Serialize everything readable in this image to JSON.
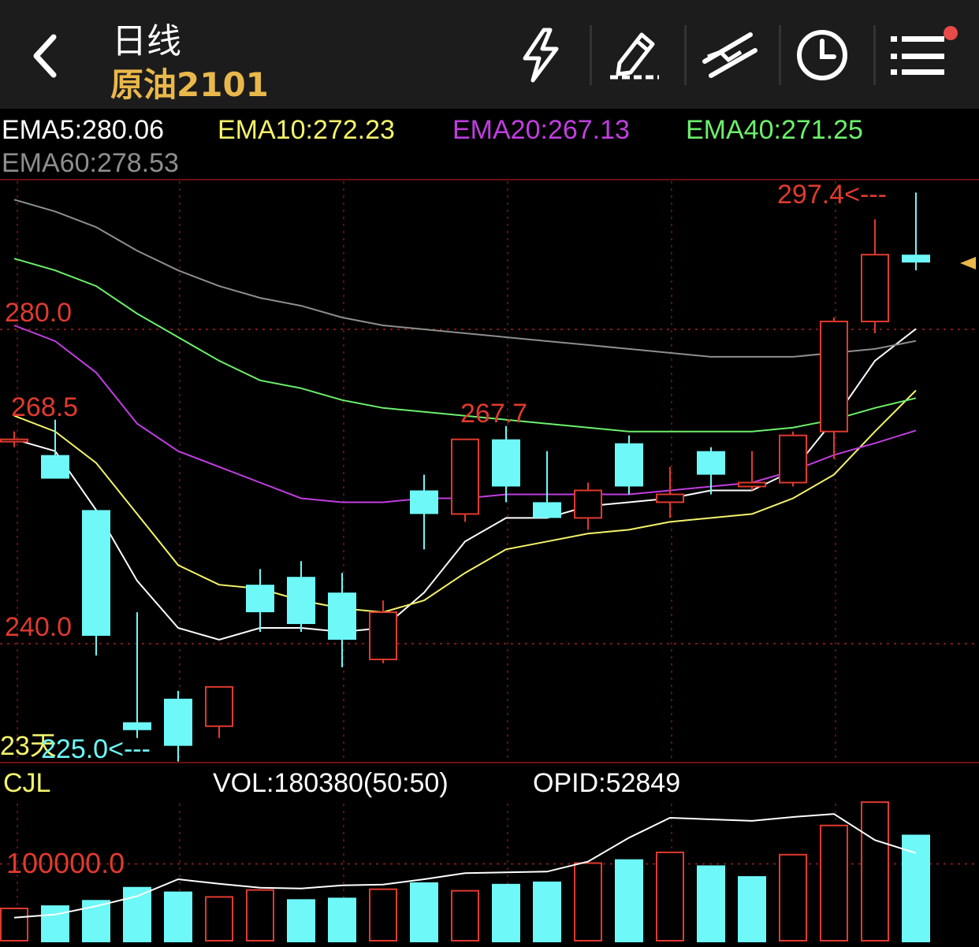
{
  "header": {
    "back_icon": "chevron-left-icon",
    "period": "日线",
    "instrument": "原油2101",
    "instrument_color": "#e9b84a",
    "buttons": [
      {
        "id": "flash",
        "icon": "lightning-icon"
      },
      {
        "id": "draw",
        "icon": "pen-draw-icon"
      },
      {
        "id": "trend",
        "icon": "trendline-icon"
      },
      {
        "id": "clock",
        "icon": "clock-icon"
      },
      {
        "id": "menu",
        "icon": "menu-icon",
        "badge_color": "#e84a4a"
      }
    ]
  },
  "ema_legend": [
    {
      "label": "EMA5:280.06",
      "color": "#ffffff"
    },
    {
      "label": "EMA10:272.23",
      "color": "#f4f46a"
    },
    {
      "label": "EMA20:267.13",
      "color": "#c03ee0"
    },
    {
      "label": "EMA40:271.25",
      "color": "#6cf06c"
    },
    {
      "label": "EMA60:278.53",
      "color": "#8e8e8e"
    }
  ],
  "chart_data": [
    {
      "type": "candlestick",
      "price_labels": {
        "level_280": "280.0",
        "level_268": "268.5",
        "level_240": "240.0",
        "level_267": "267.7"
      },
      "high_marker": "297.4<---",
      "low_marker": "225.0<---",
      "days_label": "23天",
      "gridlines": [
        295.0,
        280.0,
        240.0
      ],
      "up_color": "#e03a2e",
      "down_color": "#6ef8f8",
      "candles": [
        {
          "o": 266.0,
          "h": 267.0,
          "l": 265.0,
          "c": 266.0
        },
        {
          "o": 264.0,
          "h": 268.5,
          "l": 261.0,
          "c": 261.0
        },
        {
          "o": 257.0,
          "h": 257.0,
          "l": 238.5,
          "c": 241.0
        },
        {
          "o": 230.0,
          "h": 244.0,
          "l": 228.0,
          "c": 229.0
        },
        {
          "o": 233.0,
          "h": 234.0,
          "l": 225.0,
          "c": 227.0
        },
        {
          "o": 229.5,
          "h": 234.5,
          "l": 228.0,
          "c": 234.5
        },
        {
          "o": 247.5,
          "h": 249.5,
          "l": 241.5,
          "c": 244.0
        },
        {
          "o": 248.5,
          "h": 250.5,
          "l": 241.5,
          "c": 242.5
        },
        {
          "o": 246.5,
          "h": 249.0,
          "l": 237.0,
          "c": 240.5
        },
        {
          "o": 238.0,
          "h": 245.5,
          "l": 237.5,
          "c": 244.0
        },
        {
          "o": 259.5,
          "h": 261.5,
          "l": 252.0,
          "c": 256.5
        },
        {
          "o": 256.5,
          "h": 266.0,
          "l": 255.5,
          "c": 266.0
        },
        {
          "o": 266.0,
          "h": 267.7,
          "l": 258.0,
          "c": 260.0
        },
        {
          "o": 258.0,
          "h": 264.5,
          "l": 256.0,
          "c": 256.0
        },
        {
          "o": 256.0,
          "h": 260.5,
          "l": 254.5,
          "c": 259.5
        },
        {
          "o": 265.5,
          "h": 266.5,
          "l": 259.0,
          "c": 260.0
        },
        {
          "o": 258.0,
          "h": 262.5,
          "l": 256.0,
          "c": 259.0
        },
        {
          "o": 264.5,
          "h": 265.0,
          "l": 259.0,
          "c": 261.5
        },
        {
          "o": 260.0,
          "h": 264.5,
          "l": 259.5,
          "c": 260.5
        },
        {
          "o": 260.5,
          "h": 267.0,
          "l": 260.0,
          "c": 266.5
        },
        {
          "o": 267.0,
          "h": 281.5,
          "l": 263.5,
          "c": 281.0
        },
        {
          "o": 281.0,
          "h": 294.0,
          "l": 279.5,
          "c": 289.5
        },
        {
          "o": 289.5,
          "h": 297.4,
          "l": 287.5,
          "c": 288.5
        }
      ],
      "ema_lines": [
        {
          "name": "EMA5",
          "color": "#ffffff",
          "values": [
            266.0,
            264.5,
            257.0,
            248.0,
            242.0,
            240.5,
            242.0,
            242.0,
            241.5,
            242.0,
            246.5,
            253.0,
            256.0,
            256.0,
            257.5,
            258.0,
            258.5,
            259.5,
            259.5,
            262.0,
            268.5,
            276.0,
            280.06
          ]
        },
        {
          "name": "EMA10",
          "color": "#f4f46a",
          "values": [
            269.0,
            267.0,
            263.0,
            256.5,
            250.0,
            247.5,
            247.0,
            245.5,
            244.5,
            244.0,
            245.5,
            249.0,
            252.0,
            253.0,
            254.0,
            254.5,
            255.5,
            256.0,
            256.5,
            258.5,
            261.5,
            267.0,
            272.23
          ]
        },
        {
          "name": "EMA20",
          "color": "#c03ee0",
          "values": [
            280.5,
            278.5,
            274.5,
            268.0,
            264.5,
            262.5,
            260.5,
            258.5,
            258.0,
            258.0,
            258.5,
            258.5,
            259.0,
            259.0,
            259.0,
            259.0,
            259.5,
            260.0,
            260.5,
            262.0,
            264.0,
            265.5,
            267.13
          ]
        },
        {
          "name": "EMA40",
          "color": "#6cf06c",
          "values": [
            289.0,
            287.5,
            285.5,
            282.0,
            279.0,
            276.0,
            273.5,
            272.5,
            271.0,
            270.0,
            269.5,
            269.0,
            268.5,
            268.0,
            267.5,
            267.0,
            267.0,
            267.0,
            267.0,
            267.5,
            268.5,
            270.0,
            271.25
          ]
        },
        {
          "name": "EMA60",
          "color": "#8e8e8e",
          "values": [
            296.5,
            295.0,
            293.0,
            290.0,
            287.5,
            285.5,
            284.0,
            283.0,
            281.5,
            280.5,
            280.0,
            279.5,
            279.0,
            278.5,
            278.0,
            277.5,
            277.0,
            276.5,
            276.5,
            276.5,
            277.0,
            277.5,
            278.53
          ]
        }
      ]
    },
    {
      "type": "bar",
      "title": "CJL",
      "vol_label": "VOL:180380(50:50)",
      "opid_label": "OPID:52849",
      "level_label": "100000.0",
      "gridlines": [
        100000
      ],
      "bars": [
        {
          "v": 42000,
          "up": true
        },
        {
          "v": 46000,
          "up": false
        },
        {
          "v": 53000,
          "up": false
        },
        {
          "v": 70000,
          "up": false
        },
        {
          "v": 64000,
          "up": false
        },
        {
          "v": 57000,
          "up": true
        },
        {
          "v": 66000,
          "up": true
        },
        {
          "v": 54000,
          "up": false
        },
        {
          "v": 56000,
          "up": false
        },
        {
          "v": 67000,
          "up": true
        },
        {
          "v": 76000,
          "up": false
        },
        {
          "v": 65000,
          "up": true
        },
        {
          "v": 74000,
          "up": false
        },
        {
          "v": 77000,
          "up": false
        },
        {
          "v": 101000,
          "up": true
        },
        {
          "v": 106000,
          "up": false
        },
        {
          "v": 115000,
          "up": true
        },
        {
          "v": 98000,
          "up": false
        },
        {
          "v": 84000,
          "up": false
        },
        {
          "v": 112000,
          "up": true
        },
        {
          "v": 150000,
          "up": true
        },
        {
          "v": 180380,
          "up": true
        },
        {
          "v": 138000,
          "up": false
        }
      ],
      "open_interest_line": {
        "color": "#ffffff",
        "values": [
          30000,
          34000,
          45000,
          58000,
          80000,
          74000,
          69000,
          68000,
          72000,
          73000,
          80000,
          88000,
          89000,
          90000,
          103000,
          134000,
          160000,
          158000,
          156000,
          161000,
          165000,
          131000,
          114000
        ]
      }
    }
  ]
}
